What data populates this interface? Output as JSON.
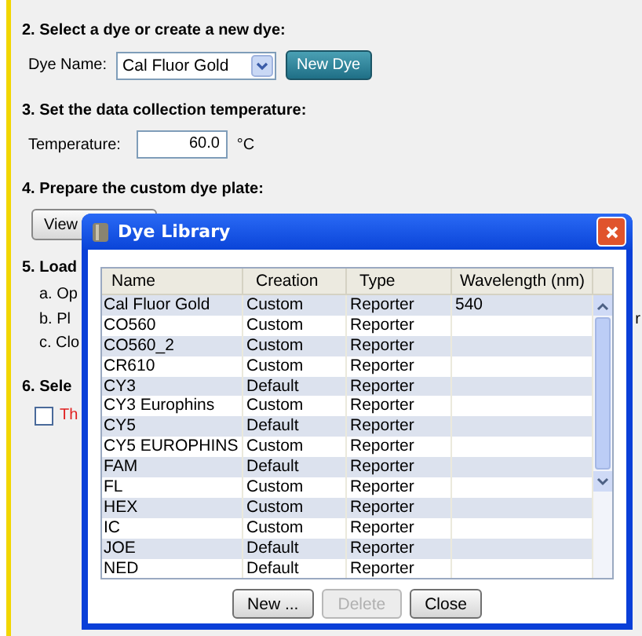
{
  "steps": [
    {
      "heading": "2. Select a dye or create a new dye:",
      "kind": "dye"
    },
    {
      "heading": "3. Set the data collection temperature:",
      "kind": "temperature"
    },
    {
      "heading": "4. Prepare the custom dye plate:",
      "kind": "view"
    },
    {
      "heading": "5. Load",
      "kind": "list"
    },
    {
      "heading": "6. Sele",
      "kind": "check"
    }
  ],
  "dye_name": {
    "label": "Dye Name:",
    "value": "Cal Fluor Gold"
  },
  "new_dye_button": "New Dye",
  "temperature": {
    "label": "Temperature:",
    "value": "60.0",
    "unit": "°C"
  },
  "view_button": "View",
  "load_items": [
    {
      "text": "a. Op"
    },
    {
      "text": "b. Pl",
      "trailing": "r"
    },
    {
      "text": "c. Clo"
    }
  ],
  "check_item": {
    "text": "Th",
    "checked": false
  },
  "dialog": {
    "title": "Dye Library",
    "columns": [
      "Name",
      "Creation",
      "Type",
      "Wavelength (nm)"
    ],
    "rows": [
      [
        "Cal Fluor Gold",
        "Custom",
        "Reporter",
        "540"
      ],
      [
        "CO560",
        "Custom",
        "Reporter",
        ""
      ],
      [
        "CO560_2",
        "Custom",
        "Reporter",
        ""
      ],
      [
        "CR610",
        "Custom",
        "Reporter",
        ""
      ],
      [
        "CY3",
        "Default",
        "Reporter",
        ""
      ],
      [
        "CY3 Europhins",
        "Custom",
        "Reporter",
        ""
      ],
      [
        "CY5",
        "Default",
        "Reporter",
        ""
      ],
      [
        "CY5 EUROPHINS",
        "Custom",
        "Reporter",
        ""
      ],
      [
        "FAM",
        "Default",
        "Reporter",
        ""
      ],
      [
        "FL",
        "Custom",
        "Reporter",
        ""
      ],
      [
        "HEX",
        "Custom",
        "Reporter",
        ""
      ],
      [
        "IC",
        "Custom",
        "Reporter",
        ""
      ],
      [
        "JOE",
        "Default",
        "Reporter",
        ""
      ],
      [
        "NED",
        "Default",
        "Reporter",
        ""
      ]
    ],
    "buttons": [
      {
        "label": "New ...",
        "disabled": false
      },
      {
        "label": "Delete",
        "disabled": true
      },
      {
        "label": "Close",
        "disabled": false
      }
    ]
  }
}
